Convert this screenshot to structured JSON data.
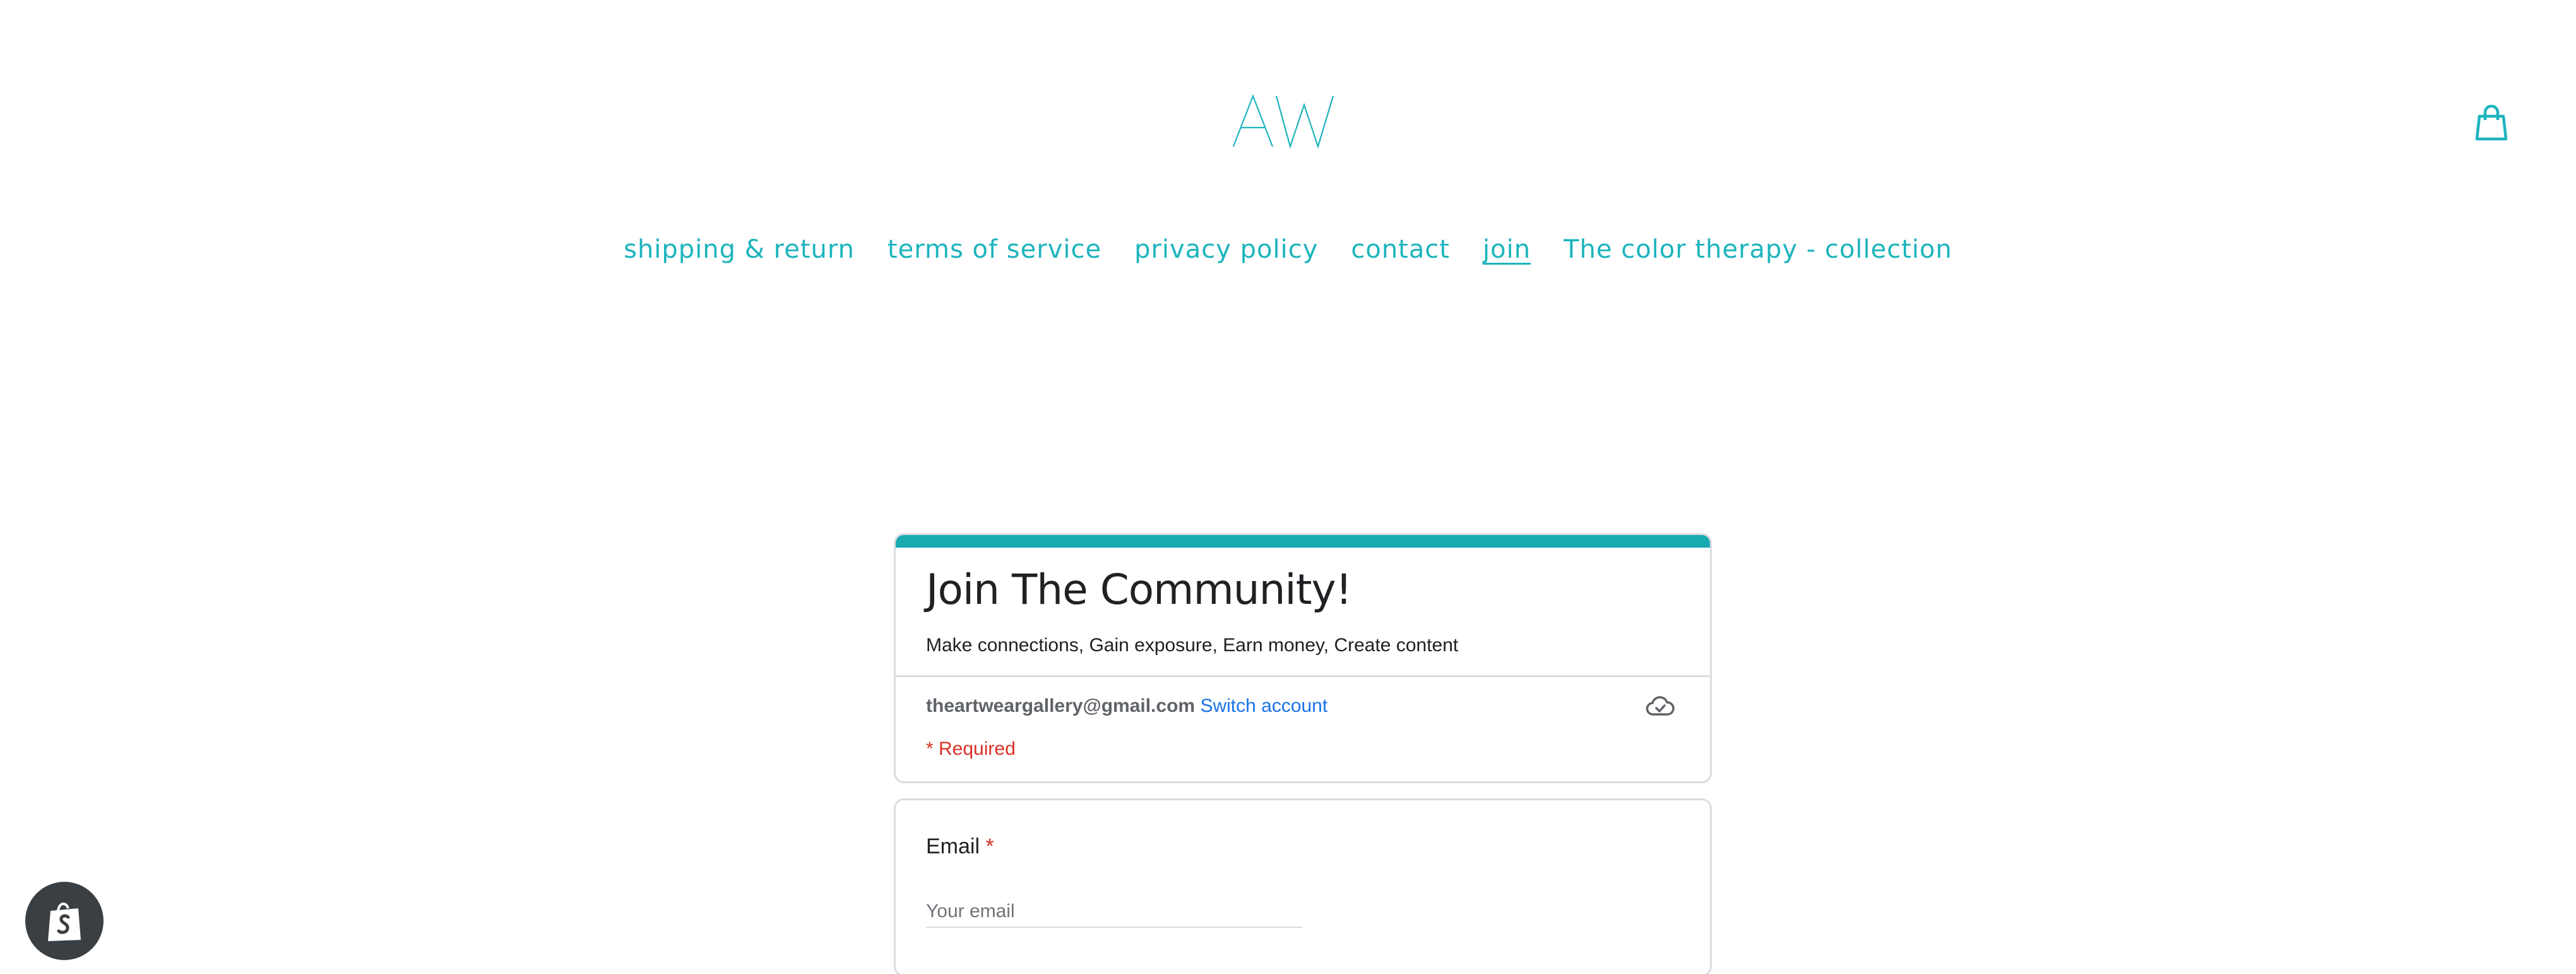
{
  "brand": {
    "logo_text": "AW",
    "accent_color": "#1cb4bd"
  },
  "header": {
    "cart_icon": "shopping-bag-icon"
  },
  "nav": {
    "items": [
      {
        "label": "shipping & return",
        "active": false
      },
      {
        "label": "terms of service",
        "active": false
      },
      {
        "label": "privacy policy",
        "active": false
      },
      {
        "label": "contact",
        "active": false
      },
      {
        "label": "join",
        "active": true
      },
      {
        "label": "The color therapy - collection",
        "active": false
      }
    ]
  },
  "form": {
    "accent_color": "#1aabb2",
    "title": "Join The Community!",
    "description": "Make connections, Gain exposure, Earn money, Create content",
    "account_email": "theartweargallery@gmail.com",
    "switch_account_label": "Switch account",
    "save_status_icon": "cloud-icon",
    "required_note": "* Required",
    "questions": [
      {
        "label": "Email",
        "required_marker": "*",
        "placeholder": "Your email",
        "value": ""
      }
    ]
  },
  "shopify_badge": {
    "icon": "shopify-bag-icon"
  }
}
